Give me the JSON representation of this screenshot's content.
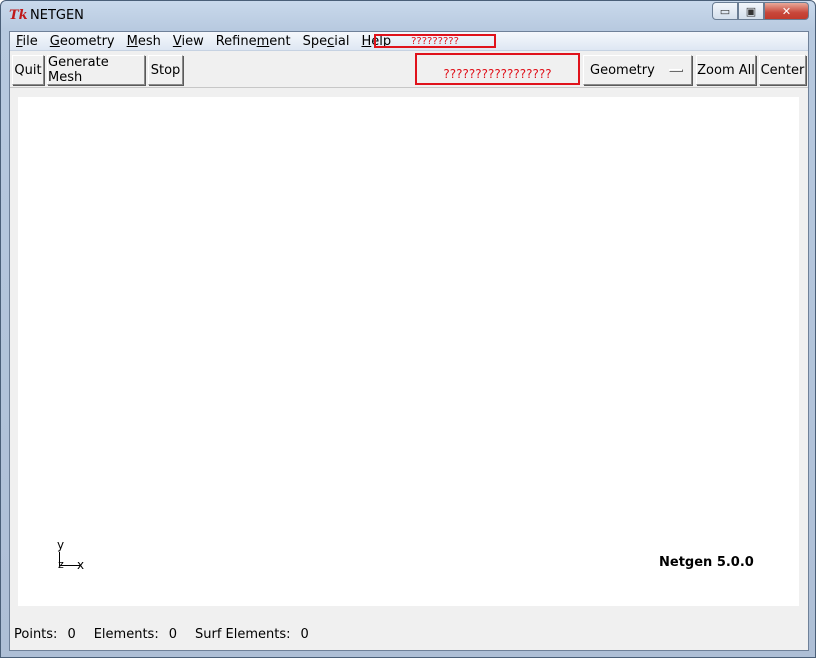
{
  "window": {
    "title": "NETGEN",
    "app_icon": "Tk",
    "caption": {
      "minimize": "▭",
      "maximize": "▣",
      "close": "✕"
    }
  },
  "menubar": {
    "items": [
      {
        "label": "File",
        "mnemonic": "F",
        "rest": "ile"
      },
      {
        "label": "Geometry",
        "mnemonic": "G",
        "rest": "eometry"
      },
      {
        "label": "Mesh",
        "mnemonic": "M",
        "rest": "esh"
      },
      {
        "label": "View",
        "mnemonic": "V",
        "rest": "iew"
      },
      {
        "label": "Refinement",
        "pre": "Refine",
        "mnemonic": "m",
        "rest": "ent"
      },
      {
        "label": "Special",
        "pre": "Spe",
        "mnemonic": "c",
        "rest": "ial"
      },
      {
        "label": "Help",
        "mnemonic": "H",
        "rest": "elp"
      }
    ],
    "highlighted_text": "?????????"
  },
  "toolbar": {
    "quit": "Quit",
    "generate_mesh": "Generate Mesh",
    "stop": "Stop",
    "highlighted_text": "?????????????????",
    "view_select": "Geometry",
    "zoom_all": "Zoom All",
    "center": "Center"
  },
  "canvas": {
    "axis_y": "y",
    "axis_z": "z",
    "axis_x": "x",
    "version": "Netgen 5.0.0"
  },
  "status": {
    "points_label": "Points:",
    "points_value": "0",
    "elements_label": "Elements:",
    "elements_value": "0",
    "surf_label": "Surf Elements:",
    "surf_value": "0"
  },
  "colors": {
    "highlight": "#e0121b",
    "app_icon": "#c01818"
  }
}
